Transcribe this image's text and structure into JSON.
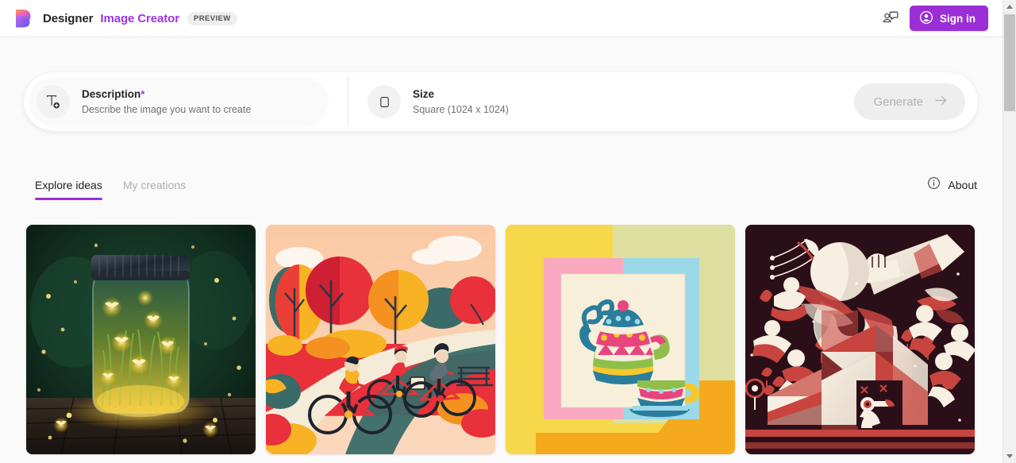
{
  "header": {
    "logo_icon": "designer-logo-icon",
    "brand": "Designer",
    "product": "Image Creator",
    "badge": "PREVIEW",
    "feedback_icon": "feedback-chat-icon",
    "signin_icon": "person-circle-icon",
    "signin_label": "Sign in",
    "accent_color": "#9b2fd6"
  },
  "prompt_bar": {
    "description": {
      "icon": "text-add-icon",
      "label": "Description",
      "required_marker": "*",
      "placeholder": "Describe the image you want to create",
      "value": ""
    },
    "size": {
      "icon": "square-shape-icon",
      "label": "Size",
      "value": "Square (1024 x 1024)"
    },
    "generate": {
      "label": "Generate",
      "icon": "arrow-right-icon",
      "enabled": false
    }
  },
  "tabs": [
    {
      "label": "Explore ideas",
      "active": true
    },
    {
      "label": "My creations",
      "active": false
    }
  ],
  "about": {
    "icon": "info-circle-icon",
    "label": "About"
  },
  "gallery": {
    "cards": [
      {
        "name": "fireflies-in-jar",
        "alt": "Glowing fireflies inside a mason jar on a wooden table at night"
      },
      {
        "name": "cyclists-in-autumn-park",
        "alt": "Flat illustration of three cyclists riding on a winding path through an autumn park"
      },
      {
        "name": "papercraft-teapot",
        "alt": "Paper craft style teapot and teacup on layered pastel panels"
      },
      {
        "name": "abstract-trumpet-figures",
        "alt": "Abstract geometric composition with a trumpet and dancing figures in red, cream and dark maroon"
      }
    ]
  },
  "scrollbar": {
    "up_icon": "scroll-up-arrow-icon",
    "down_icon": "scroll-down-arrow-icon"
  }
}
